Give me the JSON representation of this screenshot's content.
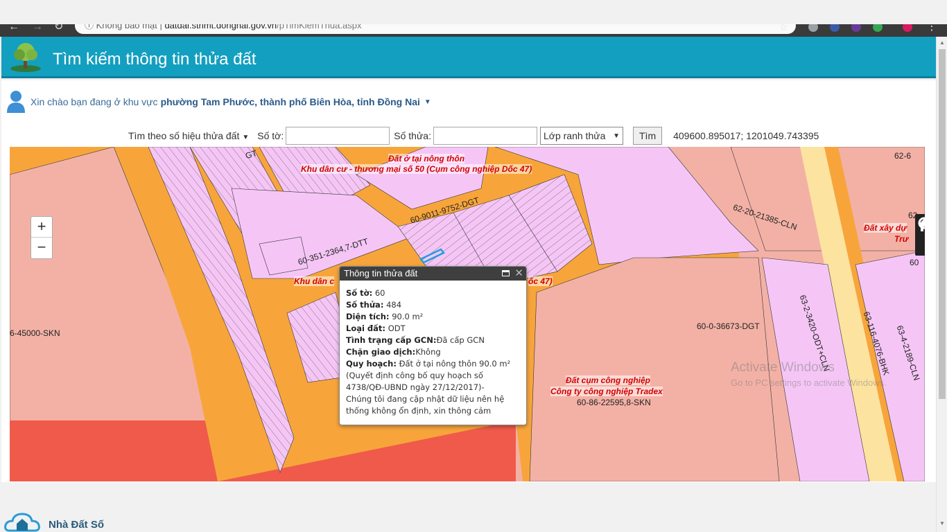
{
  "browser": {
    "security_label": "Không bảo mật",
    "url_host": "datdai.stnmt.dongnai.gov.vn",
    "url_path": "/pTimKiemThua.aspx"
  },
  "header": {
    "title": "Tìm kiếm thông tin thửa đất"
  },
  "greeting": {
    "prefix": "Xin chào bạn đang ở khu vực",
    "area": "phường Tam Phước, thành phố Biên Hòa, tỉnh Đồng Nai"
  },
  "search": {
    "mode_label": "Tìm theo số hiệu thửa đất",
    "so_to_label": "Số tờ:",
    "so_to_value": "",
    "so_thua_label": "Số thửa:",
    "so_thua_value": "",
    "layer_select": "Lớp ranh thửa",
    "button": "Tìm",
    "coords": "409600.895017; 1201049.743395"
  },
  "map": {
    "labels": {
      "l1": "Đất ở tại nông thôn",
      "l2": "Khu dân cư - thương mại số 50 (Cụm công nghiệp Dốc 47)",
      "l3": "62-6",
      "l4": "60-9011-9752-DGT",
      "l5": "60-351-2364,7-DTT",
      "l6": "62-20-21385-CLN",
      "l7": "Đất xây dự",
      "l8": "Trư",
      "l9": "Khu dân c",
      "l10": "ốc 47)",
      "l11": "6-45000-SKN",
      "l12": "60-0-36673-DGT",
      "l13": "63-2-3420-ODT+CLN",
      "l14": "63-116-4076-BHK",
      "l15": "63-4-2189-CLN",
      "l16": "Đất cụm công nghiệp",
      "l17": "Công ty công nghiệp Tradex",
      "l18": "60-86-22595,8-SKN",
      "l19": "GT",
      "l20": "62-",
      "l21": "60"
    },
    "watermark_title": "Activate Windows",
    "watermark_sub": "Go to PC settings to activate Windows."
  },
  "popup": {
    "title": "Thông tin thửa đất",
    "so_to_k": "Số tờ:",
    "so_to_v": "60",
    "so_thua_k": "Số thửa:",
    "so_thua_v": "484",
    "dien_tich_k": "Diện tích:",
    "dien_tich_v": "90.0 m²",
    "loai_dat_k": "Loại đất:",
    "loai_dat_v": "ODT",
    "tinh_trang_k": "Tình trạng cấp GCN:",
    "tinh_trang_v": "Đã cấp GCN",
    "chan_k": "Chặn giao dịch:",
    "chan_v": "Không",
    "quy_hoach_k": "Quy hoạch:",
    "quy_hoach_v": "Đất ở tại nông thôn 90.0 m²",
    "quy_hoach_note": "(Quyết định công bố quy hoạch số 4738/QĐ-UBND ngày 27/12/2017)-",
    "notice": "Chúng tôi đang cập nhật dữ liệu nên hệ thống không ổn định, xin thông cảm"
  },
  "brand": {
    "name": "Nhà Đất Số"
  },
  "colors": {
    "header": "#139fc0",
    "road": "#f7a53b",
    "residential": "#f5c6f5",
    "industrial": "#f3b1a6",
    "label_red": "#d40000"
  }
}
